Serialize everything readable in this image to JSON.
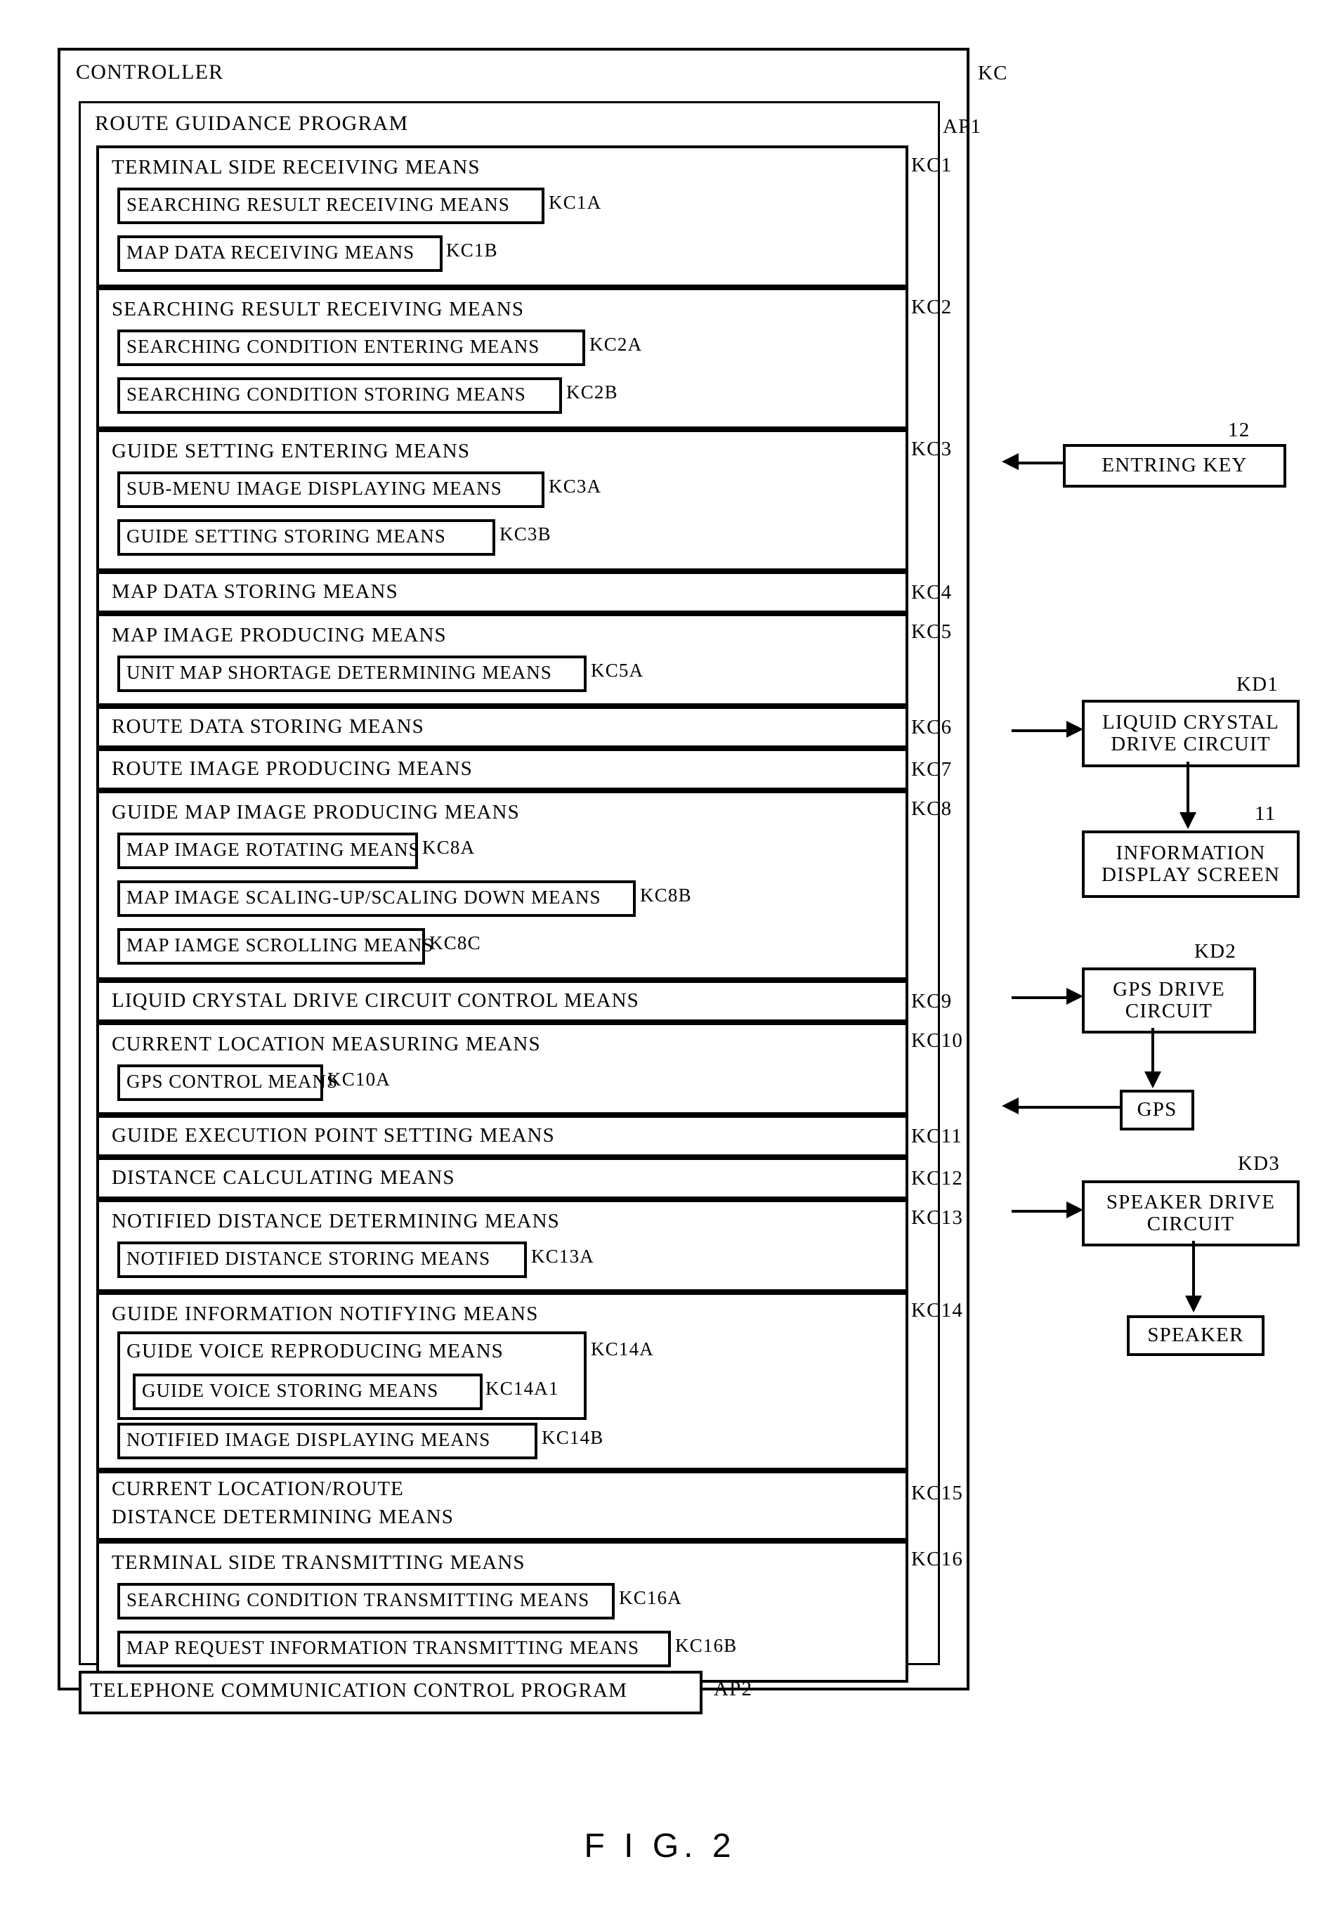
{
  "figure": {
    "caption": "F I G. 2"
  },
  "controller": {
    "title": "CONTROLLER",
    "tag": "KC",
    "program": {
      "title": "ROUTE GUIDANCE PROGRAM",
      "tag": "AP1"
    },
    "telephone_program": {
      "label": "TELEPHONE COMMUNICATION CONTROL PROGRAM",
      "tag": "AP2"
    },
    "blocks": [
      {
        "label": "TERMINAL SIDE RECEIVING MEANS",
        "tag": "KC1",
        "children": [
          {
            "label": "SEARCHING RESULT RECEIVING MEANS",
            "tag": "KC1A"
          },
          {
            "label": "MAP DATA RECEIVING MEANS",
            "tag": "KC1B"
          }
        ]
      },
      {
        "label": "SEARCHING RESULT RECEIVING MEANS",
        "tag": "KC2",
        "children": [
          {
            "label": "SEARCHING CONDITION ENTERING MEANS",
            "tag": "KC2A"
          },
          {
            "label": "SEARCHING CONDITION STORING MEANS",
            "tag": "KC2B"
          }
        ]
      },
      {
        "label": "GUIDE SETTING ENTERING MEANS",
        "tag": "KC3",
        "children": [
          {
            "label": "SUB-MENU IMAGE DISPLAYING MEANS",
            "tag": "KC3A"
          },
          {
            "label": "GUIDE SETTING STORING MEANS",
            "tag": "KC3B"
          }
        ]
      },
      {
        "label": "MAP DATA STORING MEANS",
        "tag": "KC4",
        "children": []
      },
      {
        "label": "MAP IMAGE PRODUCING MEANS",
        "tag": "KC5",
        "children": [
          {
            "label": "UNIT MAP SHORTAGE DETERMINING MEANS",
            "tag": "KC5A"
          }
        ]
      },
      {
        "label": "ROUTE DATA STORING MEANS",
        "tag": "KC6",
        "children": []
      },
      {
        "label": "ROUTE IMAGE PRODUCING MEANS",
        "tag": "KC7",
        "children": []
      },
      {
        "label": "GUIDE MAP IMAGE PRODUCING MEANS",
        "tag": "KC8",
        "children": [
          {
            "label": "MAP IMAGE ROTATING MEANS",
            "tag": "KC8A"
          },
          {
            "label": "MAP IMAGE SCALING-UP/SCALING DOWN MEANS",
            "tag": "KC8B"
          },
          {
            "label": "MAP IAMGE SCROLLING MEANS",
            "tag": "KC8C"
          }
        ]
      },
      {
        "label": "LIQUID CRYSTAL DRIVE CIRCUIT CONTROL MEANS",
        "tag": "KC9",
        "children": []
      },
      {
        "label": "CURRENT LOCATION MEASURING MEANS",
        "tag": "KC10",
        "children": [
          {
            "label": "GPS CONTROL MEANS",
            "tag": "KC10A"
          }
        ]
      },
      {
        "label": "GUIDE EXECUTION POINT SETTING MEANS",
        "tag": "KC11",
        "children": []
      },
      {
        "label": "DISTANCE CALCULATING MEANS",
        "tag": "KC12",
        "children": []
      },
      {
        "label": "NOTIFIED DISTANCE DETERMINING MEANS",
        "tag": "KC13",
        "children": [
          {
            "label": "NOTIFIED DISTANCE STORING MEANS",
            "tag": "KC13A"
          }
        ]
      },
      {
        "label": "GUIDE INFORMATION NOTIFYING MEANS",
        "tag": "KC14",
        "children": [
          {
            "label": "GUIDE VOICE REPRODUCING MEANS",
            "tag": "KC14A"
          },
          {
            "label": "GUIDE VOICE STORING MEANS",
            "tag": "KC14A1"
          },
          {
            "label": "NOTIFIED IMAGE DISPLAYING MEANS",
            "tag": "KC14B"
          }
        ]
      },
      {
        "label": "CURRENT LOCATION/ROUTE",
        "label2": "DISTANCE DETERMINING MEANS",
        "tag": "KC15",
        "children": []
      },
      {
        "label": "TERMINAL SIDE TRANSMITTING MEANS",
        "tag": "KC16",
        "children": [
          {
            "label": "SEARCHING CONDITION TRANSMITTING MEANS",
            "tag": "KC16A"
          },
          {
            "label": "MAP REQUEST INFORMATION TRANSMITTING MEANS",
            "tag": "KC16B"
          }
        ]
      }
    ]
  },
  "peripherals": [
    {
      "label": "ENTRING KEY",
      "tag": "12"
    },
    {
      "label_line1": "LIQUID CRYSTAL",
      "label_line2": "DRIVE CIRCUIT",
      "tag": "KD1"
    },
    {
      "label_line1": "INFORMATION",
      "label_line2": "DISPLAY SCREEN",
      "tag": "11"
    },
    {
      "label_line1": "GPS DRIVE",
      "label_line2": "CIRCUIT",
      "tag": "KD2"
    },
    {
      "label": "GPS",
      "tag": ""
    },
    {
      "label_line1": "SPEAKER DRIVE",
      "label_line2": "CIRCUIT",
      "tag": "KD3"
    },
    {
      "label": "SPEAKER",
      "tag": ""
    }
  ]
}
